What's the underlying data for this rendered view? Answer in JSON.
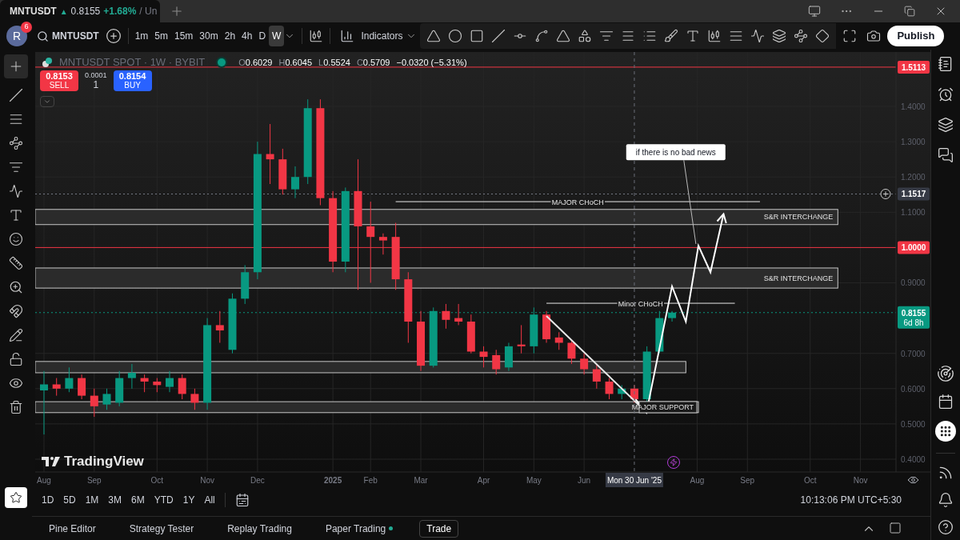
{
  "tab": {
    "symbol": "MNTUSDT",
    "arrow": "▲",
    "price": "0.8155",
    "change": "+1.68%",
    "rest": "/ Un"
  },
  "toolbar": {
    "avatar": "R",
    "badge": "6",
    "symbol": "MNTUSDT",
    "intervals": [
      {
        "label": "1m",
        "selected": false
      },
      {
        "label": "5m",
        "selected": false
      },
      {
        "label": "15m",
        "selected": false
      },
      {
        "label": "30m",
        "selected": false
      },
      {
        "label": "2h",
        "selected": false
      },
      {
        "label": "4h",
        "selected": false
      },
      {
        "label": "D",
        "selected": false
      },
      {
        "label": "W",
        "selected": true
      }
    ],
    "indicators": "Indicators",
    "publish": "Publish"
  },
  "legend": {
    "title": "MNTUSDT SPOT · 1W · BYBIT",
    "values": [
      {
        "key": "O",
        "value": "0.6029"
      },
      {
        "key": "H",
        "value": "0.6045"
      },
      {
        "key": "L",
        "value": "0.5524"
      },
      {
        "key": "C",
        "value": "0.5709"
      }
    ],
    "change": "−0.0320 (−5.31%)"
  },
  "trade": {
    "sell_price": "0.8153",
    "sell": "SELL",
    "spread": "0.0001",
    "quantity": "1",
    "buy_price": "0.8154",
    "buy": "BUY"
  },
  "logo": "TradingView",
  "chart": {
    "date_ticks": [
      "Aug",
      "Sep",
      "Oct",
      "Nov",
      "Dec",
      "2025",
      "Feb",
      "Mar",
      "Apr",
      "May",
      "Jun",
      "Aug",
      "Sep",
      "Oct",
      "Nov"
    ],
    "price_ticks": [
      "1.4000",
      "1.3000",
      "1.2000",
      "1.1000",
      "0.9000",
      "0.7000",
      "0.6000",
      "0.5000",
      "0.4000"
    ],
    "annotations": [
      "if there is no bad news",
      "MAJOR CHoCH",
      "S&R INTERCHANGE",
      "S&R INTERCHANGE",
      "Minor CHoCH",
      "MAJOR SUPPORT"
    ],
    "crosshair_date": "Mon 30 Jun '25"
  },
  "price_labels": [
    {
      "text": "1.5113",
      "color": "#f23645",
      "dotted": false
    },
    {
      "text": "1.1517",
      "color": "#363a45",
      "dotted": true
    },
    {
      "text": "1.0000",
      "color": "#f23645",
      "dotted": false
    },
    {
      "text": "0.8155",
      "sublabel": "6d 8h",
      "color": "#089981",
      "dotted": true
    }
  ],
  "ranges": [
    {
      "label": "1D"
    },
    {
      "label": "5D"
    },
    {
      "label": "1M"
    },
    {
      "label": "3M"
    },
    {
      "label": "6M"
    },
    {
      "label": "YTD"
    },
    {
      "label": "1Y"
    },
    {
      "label": "All"
    }
  ],
  "clock": "10:13:06 PM UTC+5:30",
  "bottom_tabs": [
    {
      "label": "Pine Editor",
      "selected": false,
      "dot": false
    },
    {
      "label": "Strategy Tester",
      "selected": false,
      "dot": false
    },
    {
      "label": "Replay Trading",
      "selected": false,
      "dot": false
    },
    {
      "label": "Paper Trading",
      "selected": false,
      "dot": true
    },
    {
      "label": "Trade",
      "selected": true,
      "dot": false
    }
  ]
}
